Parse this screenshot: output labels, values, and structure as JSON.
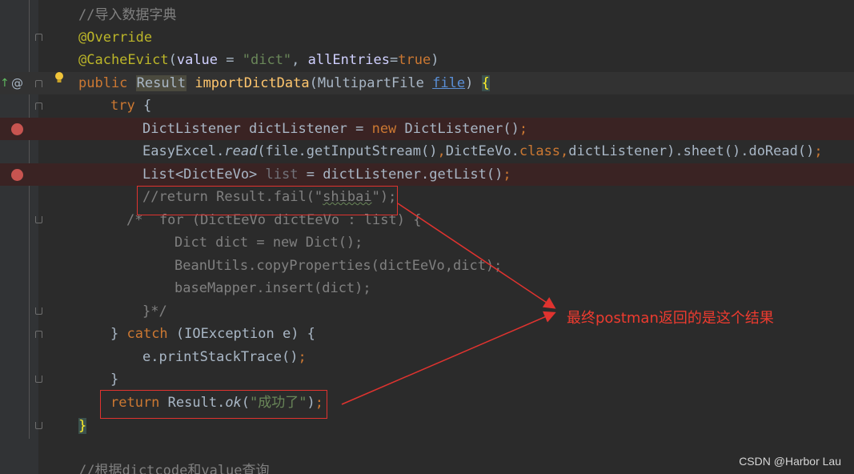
{
  "editor": {
    "lines": [
      {
        "id": "l1",
        "tokens": [
          "//导入数据字典"
        ]
      },
      {
        "id": "l2",
        "tokens": [
          "@Override"
        ]
      },
      {
        "id": "l3",
        "tokens": [
          "@CacheEvict",
          "(",
          "value",
          " = ",
          "\"dict\"",
          ", ",
          "allEntries",
          "=",
          "true",
          ")"
        ]
      },
      {
        "id": "l4",
        "tokens": [
          "public ",
          "Result",
          " ",
          "importDictData",
          "(MultipartFile ",
          "file",
          ") ",
          "{"
        ]
      },
      {
        "id": "l5",
        "tokens": [
          "try ",
          "{"
        ]
      },
      {
        "id": "l6",
        "tokens": [
          "DictListener dictListener = ",
          "new ",
          "DictListener()",
          ";"
        ]
      },
      {
        "id": "l7",
        "tokens": [
          "EasyExcel.",
          "read",
          "(file.getInputStream()",
          ",",
          "DictEeVo.",
          "class",
          ",",
          "dictListener).sheet().doRead()",
          ";"
        ]
      },
      {
        "id": "l8",
        "tokens": [
          "List<DictEeVo> ",
          "list",
          " = dictListener.getList()",
          ";"
        ]
      },
      {
        "id": "l9",
        "tokens": [
          "//return Result.fail(\"",
          "shibai",
          "\");"
        ]
      },
      {
        "id": "l10",
        "tokens": [
          "/*  for (DictEeVo dictEeVo : list) {"
        ]
      },
      {
        "id": "l11",
        "tokens": [
          "Dict dict = new Dict();"
        ]
      },
      {
        "id": "l12",
        "tokens": [
          "BeanUtils.copyProperties(dictEeVo,dict);"
        ]
      },
      {
        "id": "l13",
        "tokens": [
          "baseMapper.insert(dict);"
        ]
      },
      {
        "id": "l14",
        "tokens": [
          "}*/"
        ]
      },
      {
        "id": "l15",
        "tokens": [
          "} ",
          "catch ",
          "(IOException e) {"
        ]
      },
      {
        "id": "l16",
        "tokens": [
          "e.printStackTrace()",
          ";"
        ]
      },
      {
        "id": "l17",
        "tokens": [
          "}"
        ]
      },
      {
        "id": "l18",
        "tokens": [
          "return ",
          "Result.",
          "ok",
          "(",
          "\"成功了\"",
          ")",
          ";"
        ]
      },
      {
        "id": "l19",
        "tokens": [
          "}"
        ]
      },
      {
        "id": "l20",
        "tokens": [
          "//根据dictcode和value查询"
        ]
      }
    ]
  },
  "annotation": {
    "text": "最终postman返回的是这个结果",
    "color": "#ee3b2f"
  },
  "watermark": "CSDN @Harbor Lau",
  "gutter": {
    "at_symbol": "@",
    "icons": [
      "breakpoint-icon",
      "lightbulb-icon",
      "override-icon",
      "fold-icon"
    ]
  },
  "colors": {
    "background": "#2b2b2b",
    "keyword": "#cc7832",
    "annotation": "#bbb529",
    "string": "#6a8759",
    "comment": "#808080",
    "method": "#ffc66d",
    "breakpoint": "#c75450",
    "highlight_box": "#e0332f"
  }
}
